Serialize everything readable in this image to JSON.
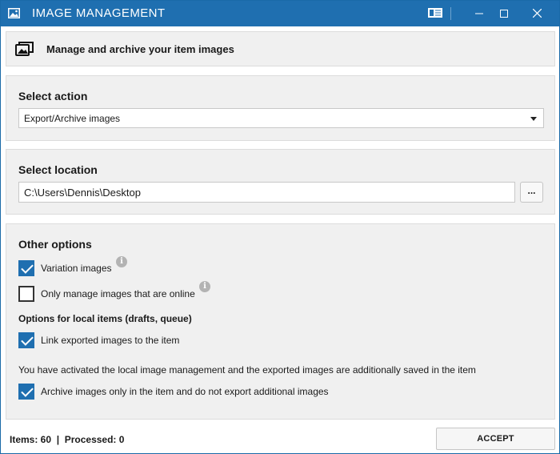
{
  "window": {
    "title": "IMAGE MANAGEMENT",
    "accent_color": "#1f6fb0",
    "title_icon": "image-icon",
    "controls": [
      "sidebar-toggle-icon",
      "minimize-icon",
      "maximize-icon",
      "close-icon"
    ]
  },
  "header": {
    "icon": "image-stack-icon",
    "text": "Manage and archive your item images"
  },
  "action": {
    "title": "Select action",
    "selected": "Export/Archive images"
  },
  "location": {
    "title": "Select location",
    "path": "C:\\Users\\Dennis\\Desktop",
    "browse_label": "..."
  },
  "options": {
    "title": "Other options",
    "variation_images": {
      "label": "Variation images",
      "checked": true
    },
    "only_online": {
      "label": "Only manage images that are online",
      "checked": false
    },
    "local_items_heading": "Options for local items (drafts, queue)",
    "link_exported": {
      "label": "Link exported images to the item",
      "checked": true
    },
    "local_note": "You have activated the local image management and the exported images are additionally saved in the item",
    "archive_only": {
      "label": "Archive images only in the item and do not export additional images",
      "checked": true
    }
  },
  "footer": {
    "status": "Items: 60  |  Processed: 0",
    "accept_label": "ACCEPT"
  }
}
